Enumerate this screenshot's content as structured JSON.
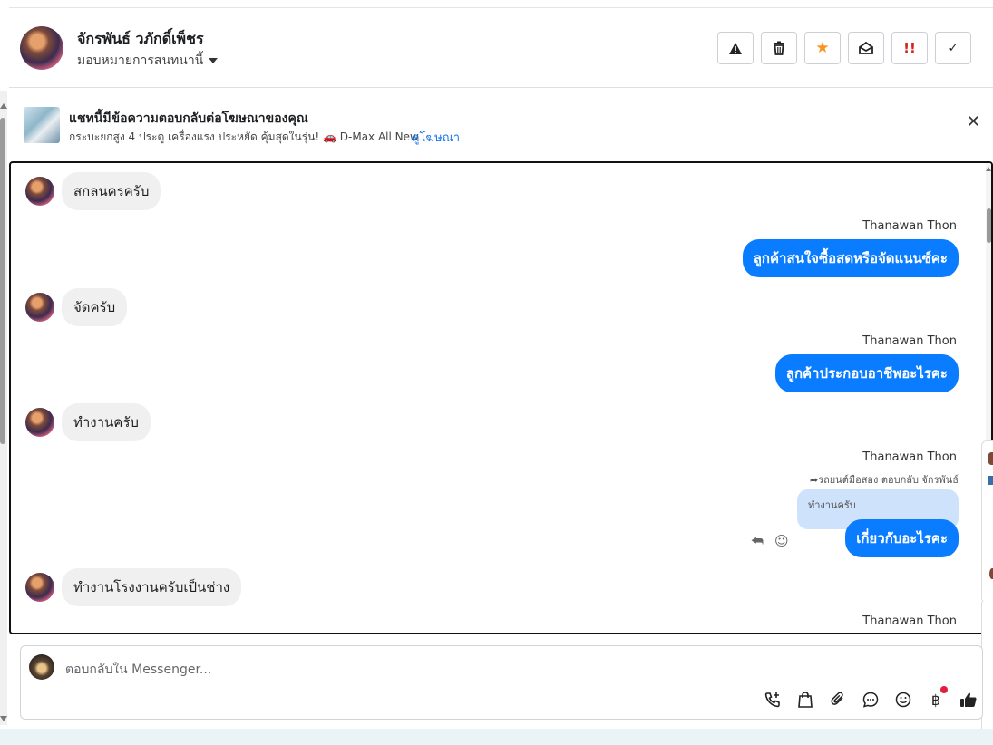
{
  "header": {
    "contact_name": "จักรพันธ์ วภักดิ์เพ็ชร",
    "assign_label": "มอบหมายการสนทนานี้",
    "actions": [
      {
        "name": "report-spam-button",
        "icon": "warning-triangle-icon",
        "glyph": "▲"
      },
      {
        "name": "delete-button",
        "icon": "trash-icon",
        "glyph": ""
      },
      {
        "name": "star-button",
        "icon": "star-icon",
        "glyph": "★"
      },
      {
        "name": "mark-unread-button",
        "icon": "envelope-open-icon",
        "glyph": ""
      },
      {
        "name": "follow-up-button",
        "icon": "double-exclamation-icon",
        "glyph": "!!"
      },
      {
        "name": "mark-done-button",
        "icon": "check-icon",
        "glyph": "✓"
      }
    ]
  },
  "banner": {
    "title": "แชทนี้มีข้อความตอบกลับต่อโฆษณาของคุณ",
    "subtitle": "กระบะยกสูง 4 ประตู เครื่องแรง ประหยัด คุ้มสุดในรุ่น! 🚗 D-Max All New ...",
    "link": "ดูโฆษณา",
    "close": "✕"
  },
  "messages": {
    "in1": "สกลนครครับ",
    "sender1": "Thanawan Thon",
    "out1": "ลูกค้าสนใจซื้อสดหรือจัดแนนซ์คะ",
    "in2": "จัดครับ",
    "sender2": "Thanawan Thon",
    "out2": "ลูกค้าประกอบอาชีพอะไรคะ",
    "in3": "ทำงานครับ",
    "sender3": "Thanawan Thon",
    "reply_ref": "รถยนต์มือสอง ตอบกลับ จักรพันธ์",
    "quoted": "ทำงานครับ",
    "out3": "เกี่ยวกับอะไรคะ",
    "in4": "ทำงานโรงงานครับเป็นช่าง",
    "sender4": "Thanawan Thon"
  },
  "composer": {
    "placeholder": "ตอบกลับใน Messenger...",
    "tools": [
      "phone-plus-icon",
      "shopping-bag-icon",
      "paperclip-icon",
      "chat-bubble-icon",
      "emoji-icon",
      "baht-icon",
      "thumbs-up-icon"
    ],
    "baht_glyph": "฿"
  },
  "colors": {
    "accent": "#0a7cff",
    "incoming_bubble": "#f0f0f0",
    "quote_bg": "#cfe2fb",
    "star": "#f7931e",
    "alert": "#e41e3f"
  }
}
